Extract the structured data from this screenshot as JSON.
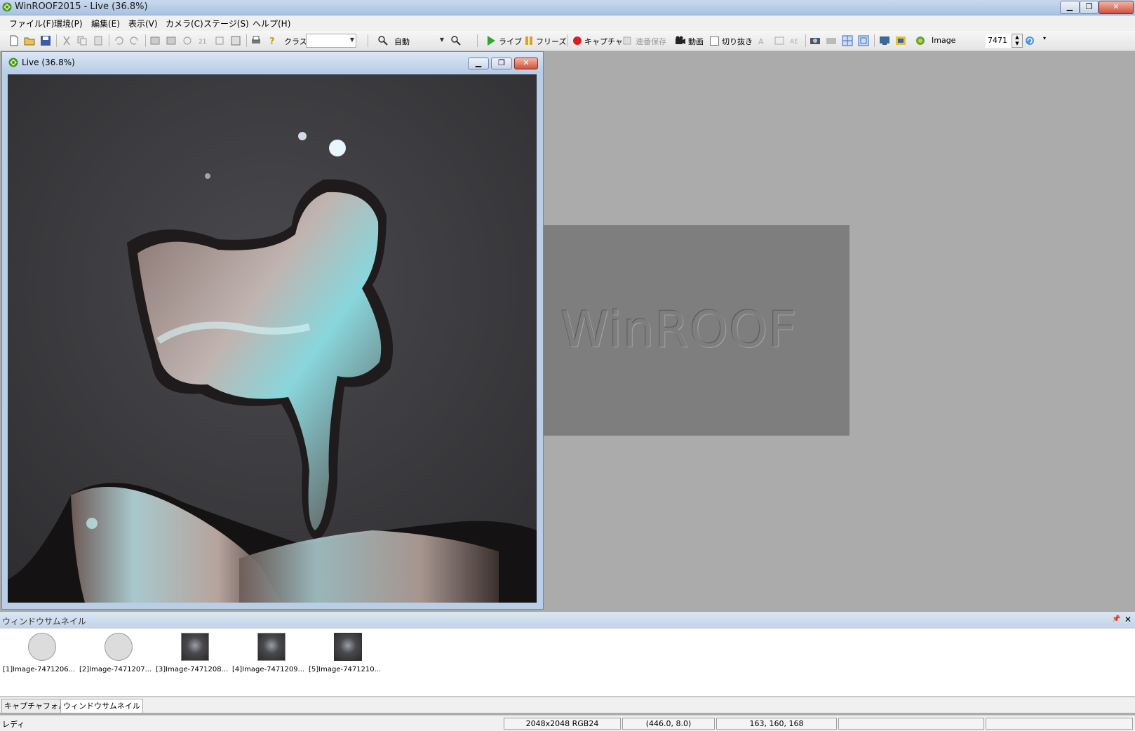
{
  "window": {
    "title": "WinROOF2015 - Live (36.8%)"
  },
  "menu": [
    "ファイル(F)",
    "環境(P)",
    "編集(E)",
    "表示(V)",
    "カメラ(C)",
    "ステージ(S)",
    "ヘルプ(H)"
  ],
  "toolbar": {
    "class_label": "クラス",
    "zoom_value": "自動",
    "live_label": "ライブ",
    "freeze_label": "フリーズ",
    "capture_label": "キャプチャ",
    "sequential_save_label": "連番保存",
    "movie_label": "動画",
    "crop_label": "切り抜き",
    "image_label": "Image",
    "image_number": "7471"
  },
  "child_window": {
    "title": "Live (36.8%)"
  },
  "watermark": "WinROOF",
  "thumbnail_panel": {
    "title": "ウィンドウサムネイル",
    "items": [
      {
        "label": "[1]Image-7471206...",
        "kind": "blank"
      },
      {
        "label": "[2]Image-7471207...",
        "kind": "blank"
      },
      {
        "label": "[3]Image-7471208...",
        "kind": "photo"
      },
      {
        "label": "[4]Image-7471209...",
        "kind": "photo"
      },
      {
        "label": "[5]Image-7471210...",
        "kind": "photo"
      }
    ]
  },
  "tabs": [
    "キャプチャフォルダ",
    "ウィンドウサムネイル"
  ],
  "status": {
    "left": "レディ",
    "image_info": "2048x2048 RGB24",
    "coordinates": "(446.0, 8.0)",
    "pixel_value": "163, 160, 168"
  }
}
